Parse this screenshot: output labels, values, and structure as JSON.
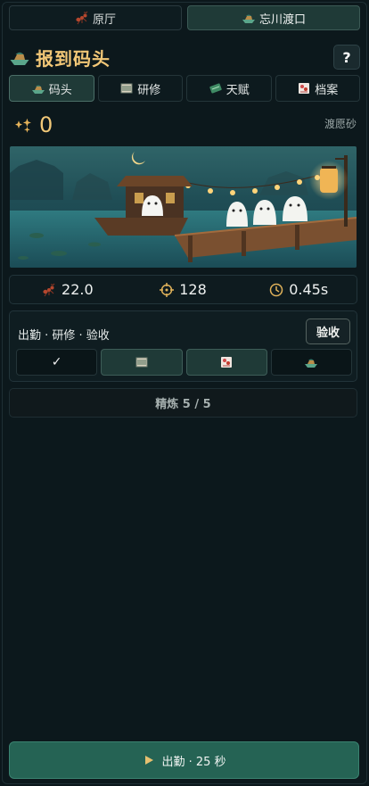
{
  "top_tabs": [
    {
      "label": "原厅",
      "icon": "ant-icon",
      "active": false
    },
    {
      "label": "忘川渡口",
      "icon": "boat-icon",
      "active": true
    }
  ],
  "header": {
    "title": "报到码头",
    "help_label": "?"
  },
  "sub_tabs": [
    {
      "label": "码头",
      "icon": "boat-icon",
      "active": true
    },
    {
      "label": "研修",
      "icon": "scroll-icon",
      "active": false
    },
    {
      "label": "天赋",
      "icon": "leaf-icon",
      "active": false
    },
    {
      "label": "档案",
      "icon": "file-icon",
      "active": false
    }
  ],
  "currency": {
    "value": "0",
    "name": "渡愿砂",
    "icon": "sparkle-icon"
  },
  "stats": {
    "power": "22.0",
    "accuracy": "128",
    "interval": "0.45s"
  },
  "job": {
    "label": "出勤 · 研修 · 验收",
    "verify_label": "验收",
    "check_mark": "✓"
  },
  "refine": {
    "label": "精炼 5 / 5"
  },
  "start": {
    "label": "出勤 · 25 秒"
  },
  "colors": {
    "accent_gold": "#f2c777",
    "primary_button": "#256354",
    "tab_active": "#1f3a37"
  }
}
